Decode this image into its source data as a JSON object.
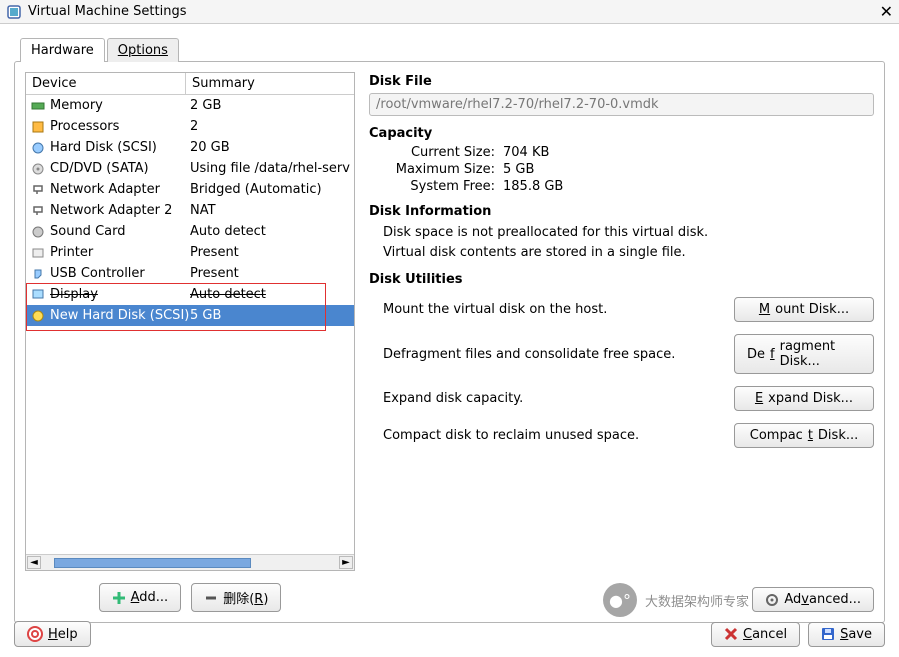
{
  "window": {
    "title": "Virtual Machine Settings"
  },
  "tabs": {
    "hardware": "Hardware",
    "options": "Options"
  },
  "table": {
    "head_device": "Device",
    "head_summary": "Summary",
    "rows": [
      {
        "device": "Memory",
        "summary": "2 GB"
      },
      {
        "device": "Processors",
        "summary": "2"
      },
      {
        "device": "Hard Disk (SCSI)",
        "summary": "20 GB"
      },
      {
        "device": "CD/DVD (SATA)",
        "summary": "Using file /data/rhel-serv"
      },
      {
        "device": "Network Adapter",
        "summary": "Bridged (Automatic)"
      },
      {
        "device": "Network Adapter 2",
        "summary": "NAT"
      },
      {
        "device": "Sound Card",
        "summary": "Auto detect"
      },
      {
        "device": "Printer",
        "summary": "Present"
      },
      {
        "device": "USB Controller",
        "summary": "Present"
      },
      {
        "device": "Display",
        "summary": "Auto detect"
      },
      {
        "device": "New Hard Disk (SCSI)",
        "summary": "5 GB"
      }
    ]
  },
  "buttons": {
    "add": "Add...",
    "remove": "删除(R)",
    "advanced": "Advanced...",
    "help": "Help",
    "cancel": "Cancel",
    "save": "Save",
    "mount": "Mount Disk...",
    "defrag": "Defragment Disk...",
    "expand": "Expand Disk...",
    "compact": "Compact Disk..."
  },
  "right": {
    "diskfile_label": "Disk File",
    "diskfile_value": "/root/vmware/rhel7.2-70/rhel7.2-70-0.vmdk",
    "capacity_label": "Capacity",
    "cap_current_k": "Current Size:",
    "cap_current_v": "704 KB",
    "cap_max_k": "Maximum Size:",
    "cap_max_v": "5 GB",
    "cap_free_k": "System Free:",
    "cap_free_v": "185.8 GB",
    "diskinfo_label": "Disk Information",
    "diskinfo_1": "Disk space is not preallocated for this virtual disk.",
    "diskinfo_2": "Virtual disk contents are stored in a single file.",
    "utilities_label": "Disk Utilities",
    "util_mount": "Mount the virtual disk on the host.",
    "util_defrag": "Defragment files and consolidate free space.",
    "util_expand": "Expand disk capacity.",
    "util_compact": "Compact disk to reclaim unused space."
  },
  "watermark": "大数据架构师专家"
}
